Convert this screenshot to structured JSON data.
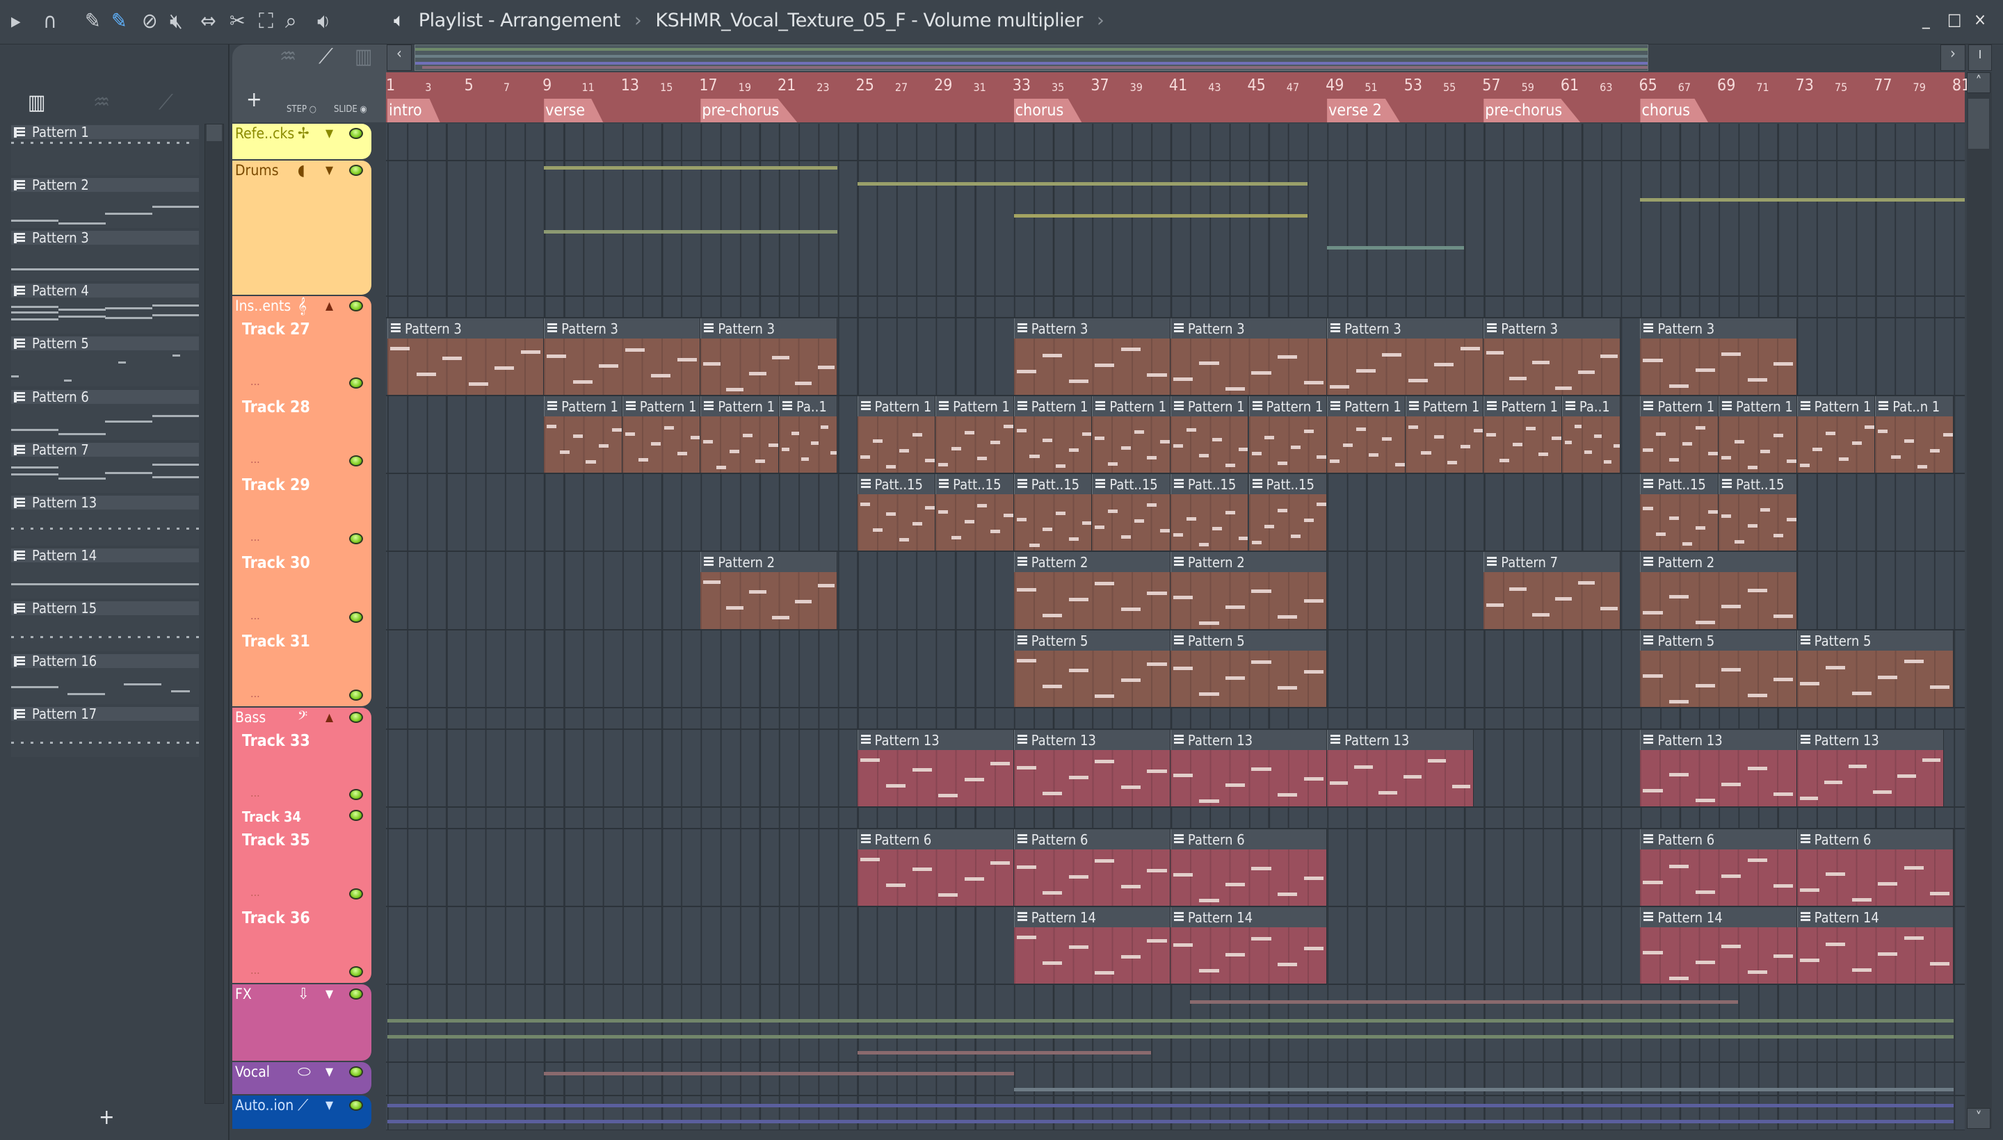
{
  "toolbar": {
    "icons": [
      "play-arrow-icon",
      "magnet-icon",
      "pencil-icon",
      "paint-brush-icon",
      "delete-icon",
      "mute-icon",
      "slip-icon",
      "slice-icon",
      "select-icon",
      "zoom-icon",
      "playback-icon"
    ],
    "title": "Playlist - Arrangement",
    "breadcrumb_sep": "›",
    "subtitle": "KSHMR_Vocal_Texture_05_F - Volume multiplier",
    "window_controls": [
      "_",
      "□",
      "×"
    ]
  },
  "left_panel": {
    "add_label": "+",
    "patterns": [
      "Pattern 1",
      "Pattern 2",
      "Pattern 3",
      "Pattern 4",
      "Pattern 5",
      "Pattern 6",
      "Pattern 7",
      "Pattern 13",
      "Pattern 14",
      "Pattern 15",
      "Pattern 16",
      "Pattern 17"
    ]
  },
  "playlist_controls": {
    "add_track": "+",
    "step_label": "STEP",
    "slide_label": "SLIDE"
  },
  "ruler": {
    "first_bar": 1,
    "last_bar": 81,
    "markers": [
      {
        "label": "intro",
        "bar": 1
      },
      {
        "label": "verse",
        "bar": 9
      },
      {
        "label": "pre-chorus",
        "bar": 17
      },
      {
        "label": "chorus",
        "bar": 33
      },
      {
        "label": "verse 2",
        "bar": 49
      },
      {
        "label": "pre-chorus",
        "bar": 57
      },
      {
        "label": "chorus",
        "bar": 65
      }
    ]
  },
  "tracks": [
    {
      "id": "refe",
      "name": "Refe..cks",
      "group": true,
      "color": "#ffff9e",
      "text": "#8a8a00",
      "icon": "waveform-icon",
      "arrow": "down"
    },
    {
      "id": "drums",
      "name": "Drums",
      "group": true,
      "color": "#ffd38a",
      "text": "#7a4a00",
      "icon": "drum-icon",
      "arrow": "down"
    },
    {
      "id": "ins",
      "name": "Ins..ents",
      "group": true,
      "color": "#ffa57e",
      "text": "#ffffff",
      "icon": "treble-clef-icon",
      "arrow": "up"
    },
    {
      "id": "t27",
      "name": "Track 27",
      "color": "#ffa57e",
      "clipColor": "#855a4e",
      "clips": [
        {
          "label": "Pattern 3",
          "start": 1,
          "length": 8
        },
        {
          "label": "Pattern 3",
          "start": 9,
          "length": 8
        },
        {
          "label": "Pattern 3",
          "start": 17,
          "length": 7
        },
        {
          "label": "Pattern 3",
          "start": 33,
          "length": 8
        },
        {
          "label": "Pattern 3",
          "start": 41,
          "length": 8
        },
        {
          "label": "Pattern 3",
          "start": 49,
          "length": 8
        },
        {
          "label": "Pattern 3",
          "start": 57,
          "length": 7
        },
        {
          "label": "Pattern 3",
          "start": 65,
          "length": 8
        }
      ]
    },
    {
      "id": "t28",
      "name": "Track 28",
      "color": "#ffa57e",
      "clipColor": "#855a4e",
      "clips": [
        {
          "label": "Pattern 1",
          "start": 9,
          "length": 4
        },
        {
          "label": "Pattern 1",
          "start": 13,
          "length": 4
        },
        {
          "label": "Pattern 1",
          "start": 17,
          "length": 4
        },
        {
          "label": "Pa..1",
          "start": 21,
          "length": 3
        },
        {
          "label": "Pattern 1",
          "start": 25,
          "length": 4
        },
        {
          "label": "Pattern 1",
          "start": 29,
          "length": 4
        },
        {
          "label": "Pattern 1",
          "start": 33,
          "length": 4
        },
        {
          "label": "Pattern 1",
          "start": 37,
          "length": 4
        },
        {
          "label": "Pattern 1",
          "start": 41,
          "length": 4
        },
        {
          "label": "Pattern 1",
          "start": 45,
          "length": 4
        },
        {
          "label": "Pattern 1",
          "start": 49,
          "length": 4
        },
        {
          "label": "Pattern 1",
          "start": 53,
          "length": 4
        },
        {
          "label": "Pattern 1",
          "start": 57,
          "length": 4
        },
        {
          "label": "Pa..1",
          "start": 61,
          "length": 3
        },
        {
          "label": "Pattern 1",
          "start": 65,
          "length": 4
        },
        {
          "label": "Pattern 1",
          "start": 69,
          "length": 4
        },
        {
          "label": "Pattern 1",
          "start": 73,
          "length": 4
        },
        {
          "label": "Pat..n 1",
          "start": 77,
          "length": 4
        }
      ]
    },
    {
      "id": "t29",
      "name": "Track 29",
      "color": "#ffa57e",
      "clipColor": "#855a4e",
      "clips": [
        {
          "label": "Patt..15",
          "start": 25,
          "length": 4
        },
        {
          "label": "Patt..15",
          "start": 29,
          "length": 4
        },
        {
          "label": "Patt..15",
          "start": 33,
          "length": 4
        },
        {
          "label": "Patt..15",
          "start": 37,
          "length": 4
        },
        {
          "label": "Patt..15",
          "start": 41,
          "length": 4
        },
        {
          "label": "Patt..15",
          "start": 45,
          "length": 4
        },
        {
          "label": "Patt..15",
          "start": 65,
          "length": 4
        },
        {
          "label": "Patt..15",
          "start": 69,
          "length": 4
        }
      ]
    },
    {
      "id": "t30",
      "name": "Track 30",
      "color": "#ffa57e",
      "clipColor": "#855a4e",
      "clips": [
        {
          "label": "Pattern 2",
          "start": 17,
          "length": 7
        },
        {
          "label": "Pattern 2",
          "start": 33,
          "length": 8
        },
        {
          "label": "Pattern 2",
          "start": 41,
          "length": 8
        },
        {
          "label": "Pattern 7",
          "start": 57,
          "length": 7
        },
        {
          "label": "Pattern 2",
          "start": 65,
          "length": 8
        }
      ]
    },
    {
      "id": "t31",
      "name": "Track 31",
      "color": "#ffa57e",
      "clipColor": "#855a4e",
      "clips": [
        {
          "label": "Pattern 5",
          "start": 33,
          "length": 8
        },
        {
          "label": "Pattern 5",
          "start": 41,
          "length": 8
        },
        {
          "label": "Pattern 5",
          "start": 65,
          "length": 8
        },
        {
          "label": "Pattern 5",
          "start": 73,
          "length": 8
        }
      ]
    },
    {
      "id": "bass",
      "name": "Bass",
      "group": true,
      "color": "#f47b8a",
      "text": "#ffffff",
      "icon": "bass-clef-icon",
      "arrow": "up"
    },
    {
      "id": "t33",
      "name": "Track 33",
      "color": "#f47b8a",
      "clipColor": "#9a4f5d",
      "clips": [
        {
          "label": "Pattern 13",
          "start": 25,
          "length": 8
        },
        {
          "label": "Pattern 13",
          "start": 33,
          "length": 8
        },
        {
          "label": "Pattern 13",
          "start": 41,
          "length": 8
        },
        {
          "label": "Pattern 13",
          "start": 49,
          "length": 7.5
        },
        {
          "label": "Pattern 13",
          "start": 65,
          "length": 8
        },
        {
          "label": "Pattern 13",
          "start": 73,
          "length": 7.5
        }
      ]
    },
    {
      "id": "t34",
      "name": "Track 34",
      "color": "#f47b8a",
      "clipColor": "#9a4f5d",
      "clips": []
    },
    {
      "id": "t35",
      "name": "Track 35",
      "color": "#f47b8a",
      "clipColor": "#9a4f5d",
      "clips": [
        {
          "label": "Pattern 6",
          "start": 25,
          "length": 8
        },
        {
          "label": "Pattern 6",
          "start": 33,
          "length": 8
        },
        {
          "label": "Pattern 6",
          "start": 41,
          "length": 8
        },
        {
          "label": "Pattern 6",
          "start": 65,
          "length": 8
        },
        {
          "label": "Pattern 6",
          "start": 73,
          "length": 8
        }
      ]
    },
    {
      "id": "t36",
      "name": "Track 36",
      "color": "#f47b8a",
      "clipColor": "#9a4f5d",
      "clips": [
        {
          "label": "Pattern 14",
          "start": 33,
          "length": 8
        },
        {
          "label": "Pattern 14",
          "start": 41,
          "length": 8
        },
        {
          "label": "Pattern 14",
          "start": 65,
          "length": 8
        },
        {
          "label": "Pattern 14",
          "start": 73,
          "length": 8
        }
      ]
    },
    {
      "id": "fx",
      "name": "FX",
      "group": true,
      "color": "#c95e98",
      "text": "#ffffff",
      "icon": "fx-icon",
      "arrow": "down"
    },
    {
      "id": "vocal",
      "name": "Vocal",
      "group": true,
      "color": "#8b55a8",
      "text": "#ffffff",
      "icon": "lips-icon",
      "arrow": "down"
    },
    {
      "id": "auto",
      "name": "Auto..ion",
      "group": true,
      "color": "#0a4fa8",
      "text": "#cfe3ff",
      "icon": "automation-icon",
      "arrow": "down"
    }
  ],
  "track_more_label": "..."
}
